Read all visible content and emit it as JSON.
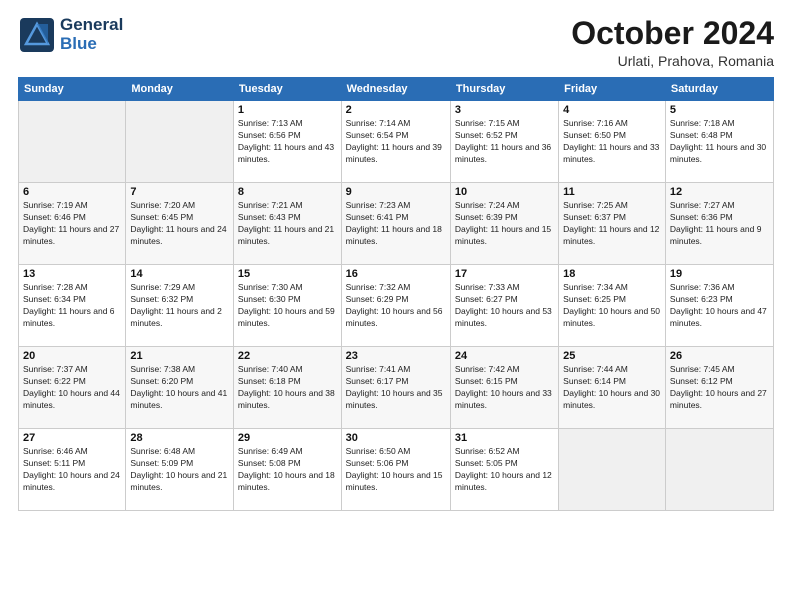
{
  "header": {
    "logo_general": "General",
    "logo_blue": "Blue",
    "month_title": "October 2024",
    "location": "Urlati, Prahova, Romania"
  },
  "weekdays": [
    "Sunday",
    "Monday",
    "Tuesday",
    "Wednesday",
    "Thursday",
    "Friday",
    "Saturday"
  ],
  "weeks": [
    [
      {
        "day": "",
        "detail": ""
      },
      {
        "day": "",
        "detail": ""
      },
      {
        "day": "1",
        "detail": "Sunrise: 7:13 AM\nSunset: 6:56 PM\nDaylight: 11 hours and 43 minutes."
      },
      {
        "day": "2",
        "detail": "Sunrise: 7:14 AM\nSunset: 6:54 PM\nDaylight: 11 hours and 39 minutes."
      },
      {
        "day": "3",
        "detail": "Sunrise: 7:15 AM\nSunset: 6:52 PM\nDaylight: 11 hours and 36 minutes."
      },
      {
        "day": "4",
        "detail": "Sunrise: 7:16 AM\nSunset: 6:50 PM\nDaylight: 11 hours and 33 minutes."
      },
      {
        "day": "5",
        "detail": "Sunrise: 7:18 AM\nSunset: 6:48 PM\nDaylight: 11 hours and 30 minutes."
      }
    ],
    [
      {
        "day": "6",
        "detail": "Sunrise: 7:19 AM\nSunset: 6:46 PM\nDaylight: 11 hours and 27 minutes."
      },
      {
        "day": "7",
        "detail": "Sunrise: 7:20 AM\nSunset: 6:45 PM\nDaylight: 11 hours and 24 minutes."
      },
      {
        "day": "8",
        "detail": "Sunrise: 7:21 AM\nSunset: 6:43 PM\nDaylight: 11 hours and 21 minutes."
      },
      {
        "day": "9",
        "detail": "Sunrise: 7:23 AM\nSunset: 6:41 PM\nDaylight: 11 hours and 18 minutes."
      },
      {
        "day": "10",
        "detail": "Sunrise: 7:24 AM\nSunset: 6:39 PM\nDaylight: 11 hours and 15 minutes."
      },
      {
        "day": "11",
        "detail": "Sunrise: 7:25 AM\nSunset: 6:37 PM\nDaylight: 11 hours and 12 minutes."
      },
      {
        "day": "12",
        "detail": "Sunrise: 7:27 AM\nSunset: 6:36 PM\nDaylight: 11 hours and 9 minutes."
      }
    ],
    [
      {
        "day": "13",
        "detail": "Sunrise: 7:28 AM\nSunset: 6:34 PM\nDaylight: 11 hours and 6 minutes."
      },
      {
        "day": "14",
        "detail": "Sunrise: 7:29 AM\nSunset: 6:32 PM\nDaylight: 11 hours and 2 minutes."
      },
      {
        "day": "15",
        "detail": "Sunrise: 7:30 AM\nSunset: 6:30 PM\nDaylight: 10 hours and 59 minutes."
      },
      {
        "day": "16",
        "detail": "Sunrise: 7:32 AM\nSunset: 6:29 PM\nDaylight: 10 hours and 56 minutes."
      },
      {
        "day": "17",
        "detail": "Sunrise: 7:33 AM\nSunset: 6:27 PM\nDaylight: 10 hours and 53 minutes."
      },
      {
        "day": "18",
        "detail": "Sunrise: 7:34 AM\nSunset: 6:25 PM\nDaylight: 10 hours and 50 minutes."
      },
      {
        "day": "19",
        "detail": "Sunrise: 7:36 AM\nSunset: 6:23 PM\nDaylight: 10 hours and 47 minutes."
      }
    ],
    [
      {
        "day": "20",
        "detail": "Sunrise: 7:37 AM\nSunset: 6:22 PM\nDaylight: 10 hours and 44 minutes."
      },
      {
        "day": "21",
        "detail": "Sunrise: 7:38 AM\nSunset: 6:20 PM\nDaylight: 10 hours and 41 minutes."
      },
      {
        "day": "22",
        "detail": "Sunrise: 7:40 AM\nSunset: 6:18 PM\nDaylight: 10 hours and 38 minutes."
      },
      {
        "day": "23",
        "detail": "Sunrise: 7:41 AM\nSunset: 6:17 PM\nDaylight: 10 hours and 35 minutes."
      },
      {
        "day": "24",
        "detail": "Sunrise: 7:42 AM\nSunset: 6:15 PM\nDaylight: 10 hours and 33 minutes."
      },
      {
        "day": "25",
        "detail": "Sunrise: 7:44 AM\nSunset: 6:14 PM\nDaylight: 10 hours and 30 minutes."
      },
      {
        "day": "26",
        "detail": "Sunrise: 7:45 AM\nSunset: 6:12 PM\nDaylight: 10 hours and 27 minutes."
      }
    ],
    [
      {
        "day": "27",
        "detail": "Sunrise: 6:46 AM\nSunset: 5:11 PM\nDaylight: 10 hours and 24 minutes."
      },
      {
        "day": "28",
        "detail": "Sunrise: 6:48 AM\nSunset: 5:09 PM\nDaylight: 10 hours and 21 minutes."
      },
      {
        "day": "29",
        "detail": "Sunrise: 6:49 AM\nSunset: 5:08 PM\nDaylight: 10 hours and 18 minutes."
      },
      {
        "day": "30",
        "detail": "Sunrise: 6:50 AM\nSunset: 5:06 PM\nDaylight: 10 hours and 15 minutes."
      },
      {
        "day": "31",
        "detail": "Sunrise: 6:52 AM\nSunset: 5:05 PM\nDaylight: 10 hours and 12 minutes."
      },
      {
        "day": "",
        "detail": ""
      },
      {
        "day": "",
        "detail": ""
      }
    ]
  ]
}
